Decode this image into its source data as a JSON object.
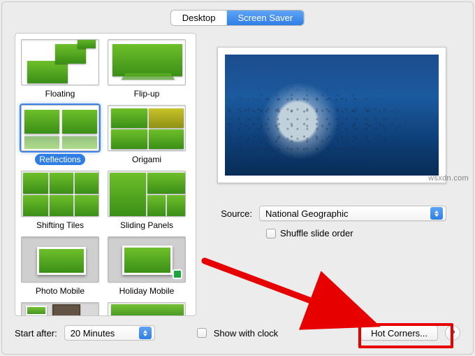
{
  "tabs": {
    "desktop": "Desktop",
    "screen_saver": "Screen Saver"
  },
  "savers": [
    {
      "label": "Floating"
    },
    {
      "label": "Flip-up"
    },
    {
      "label": "Reflections",
      "selected": true
    },
    {
      "label": "Origami"
    },
    {
      "label": "Shifting Tiles"
    },
    {
      "label": "Sliding Panels"
    },
    {
      "label": "Photo Mobile"
    },
    {
      "label": "Holiday Mobile"
    }
  ],
  "source": {
    "label": "Source:",
    "value": "National Geographic",
    "shuffle_label": "Shuffle slide order",
    "shuffle_checked": false
  },
  "bottom": {
    "start_after_label": "Start after:",
    "start_after_value": "20 Minutes",
    "show_with_clock_label": "Show with clock",
    "show_with_clock_checked": false,
    "hot_corners_label": "Hot Corners...",
    "help_label": "?"
  },
  "watermark": "wsxdn.com"
}
